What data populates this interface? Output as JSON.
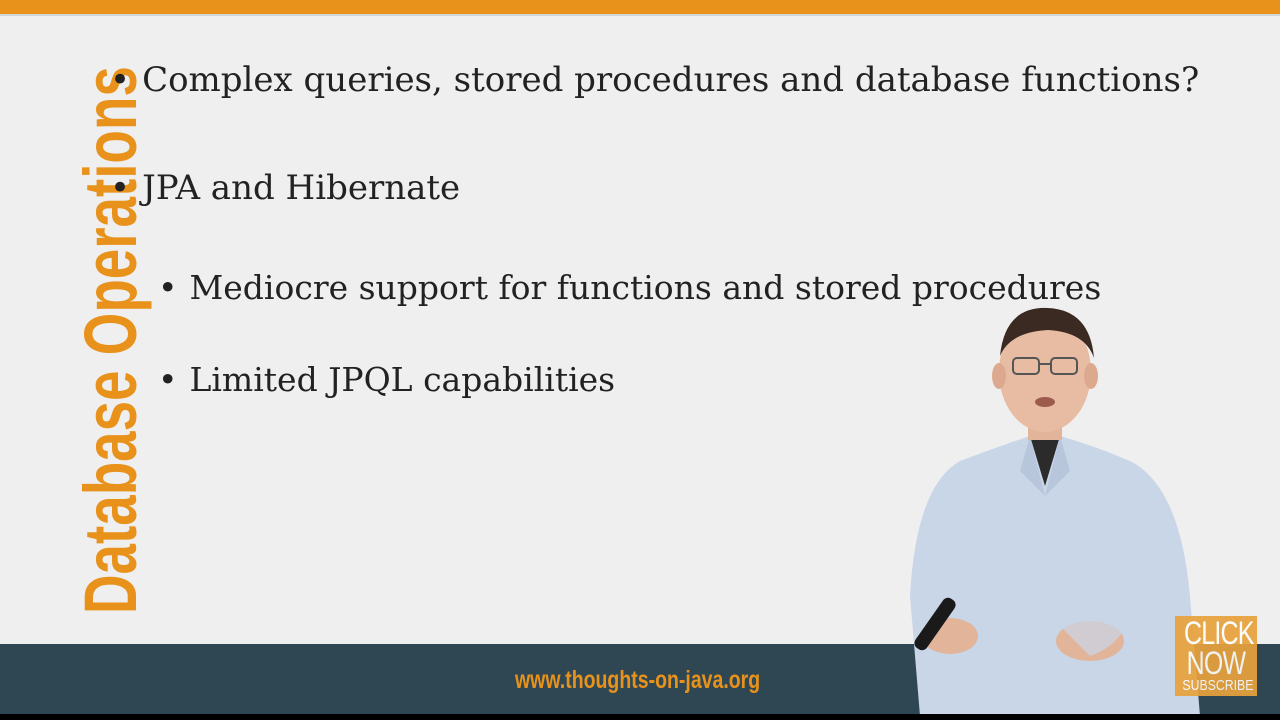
{
  "slide": {
    "side_title": "Database Operations",
    "bullets": [
      {
        "text": "Complex queries, stored procedures and database functions?"
      },
      {
        "text": "JPA and Hibernate"
      },
      {
        "text": "Mediocre support for functions and stored procedures"
      },
      {
        "text": "Limited JPQL capabilities"
      }
    ],
    "bullet_symbol": "•"
  },
  "footer": {
    "website": "www.thoughts-on-java.org"
  },
  "subscribe_button": {
    "line1": "CLICK",
    "line2": "NOW",
    "line3": "SUBSCRIBE"
  },
  "colors": {
    "accent": "#e8921b",
    "footer_bg": "#2f4753",
    "slide_bg": "#efefef"
  },
  "icons": {
    "presenter": "presenter-figure"
  }
}
